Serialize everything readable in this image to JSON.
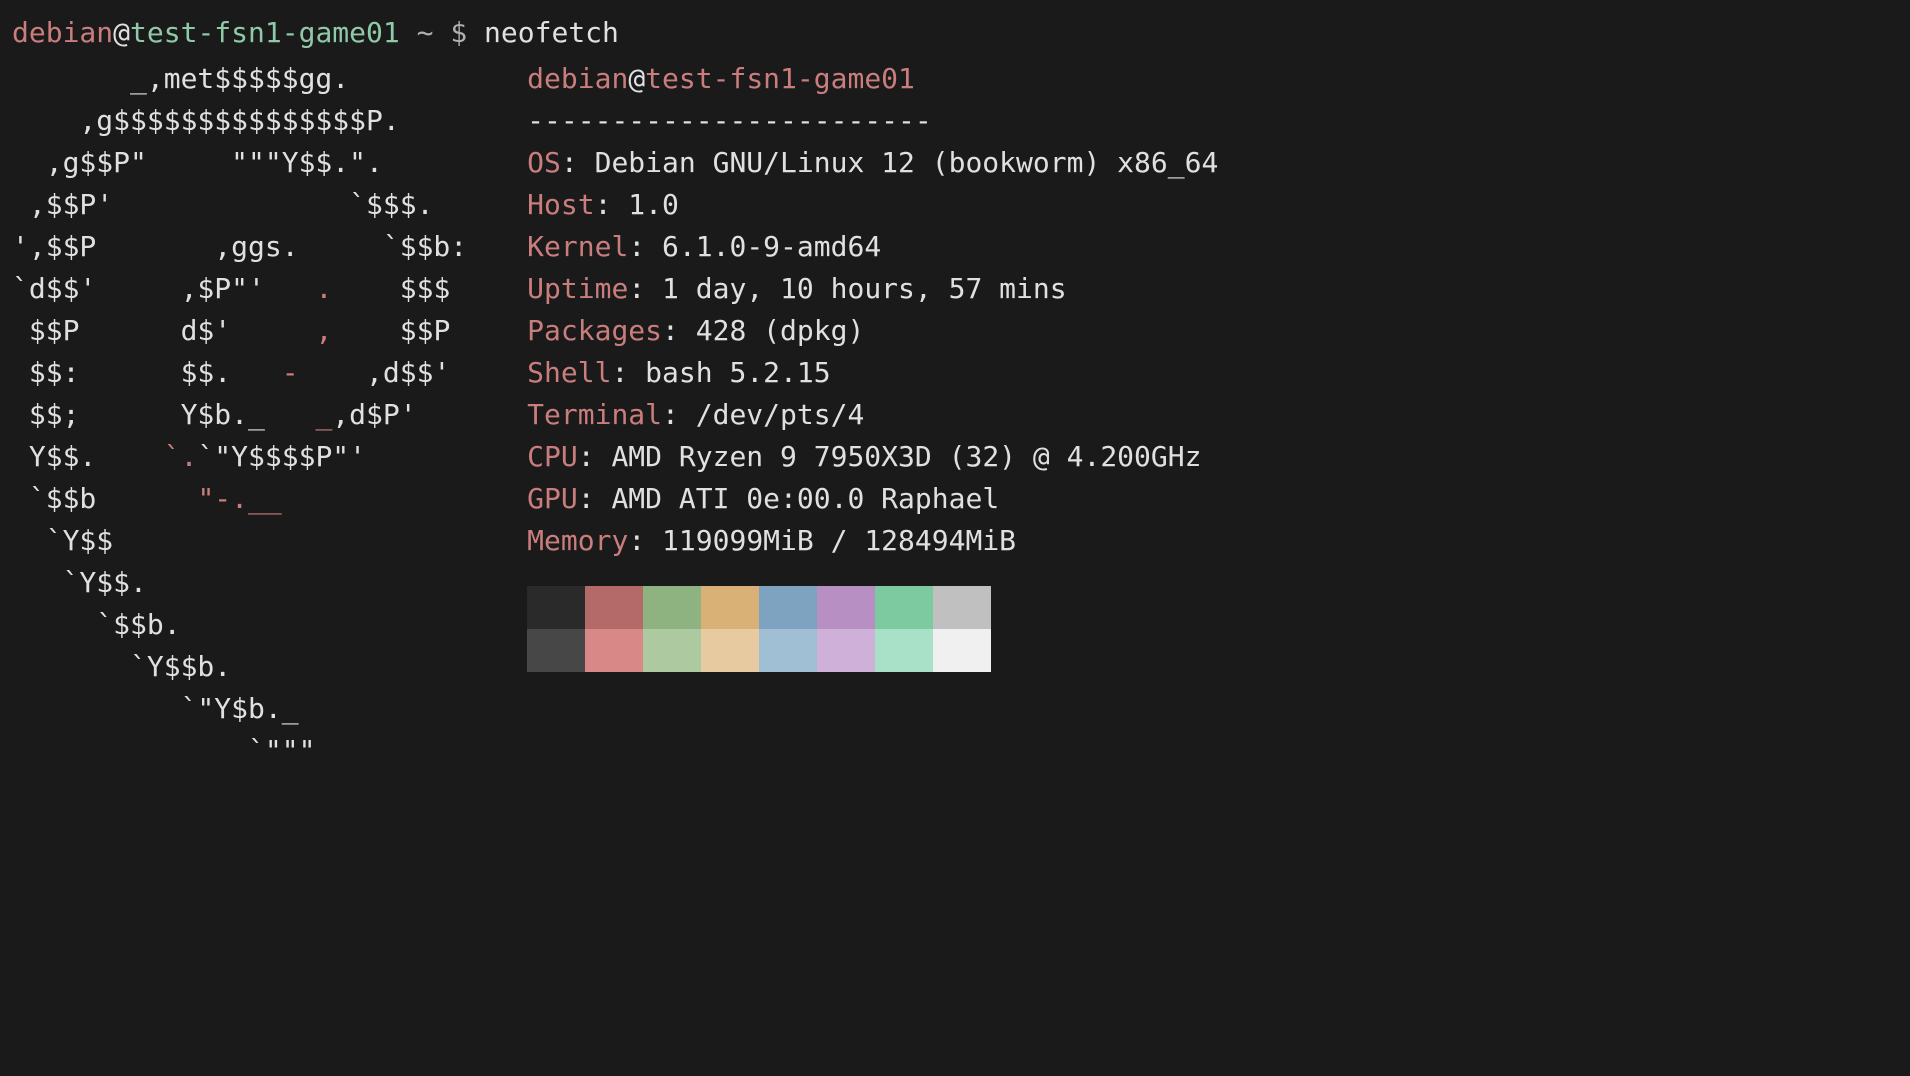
{
  "prompt": {
    "user": "debian",
    "at": "@",
    "host": "test-fsn1-game01",
    "path": "~",
    "symbol": "$",
    "command": "neofetch"
  },
  "ascii": {
    "l0": "       _,met$$$$$gg.",
    "l1": "    ,g$$$$$$$$$$$$$$$P.",
    "l2": "  ,g$$P\"     \"\"\"Y$$.\".",
    "l3": " ,$$P'              `$$$.",
    "l4": "',$$P       ,ggs.     `$$b:",
    "l5a": "`d$$'     ,$P\"'   ",
    "l5b": ".",
    "l5c": "    $$$",
    "l6a": " $$P      d$'     ",
    "l6b": ",",
    "l6c": "    $$P",
    "l7a": " $$:      $$.   ",
    "l7b": "-",
    "l7c": "    ,d$$'",
    "l8a": " $$;      Y$b._   ",
    "l8b": "_",
    "l8c": ",d$P'",
    "l9a": " Y$$.    ",
    "l9b": "`.",
    "l9c": "`\"Y$$$$P\"'",
    "l10a": " `$$b      ",
    "l10b": "\"-.__",
    "l11": "  `Y$$",
    "l12": "   `Y$$.",
    "l13": "     `$$b.",
    "l14": "       `Y$$b.",
    "l15": "          `\"Y$b._",
    "l16": "              `\"\"\""
  },
  "header": {
    "user": "debian",
    "at": "@",
    "host": "test-fsn1-game01"
  },
  "dashes": "------------------------",
  "info": {
    "os_label": "OS",
    "os_value": ": Debian GNU/Linux 12 (bookworm) x86_64",
    "host_label": "Host",
    "host_value": ": 1.0",
    "kernel_label": "Kernel",
    "kernel_value": ": 6.1.0-9-amd64",
    "uptime_label": "Uptime",
    "uptime_value": ": 1 day, 10 hours, 57 mins",
    "packages_label": "Packages",
    "packages_value": ": 428 (dpkg)",
    "shell_label": "Shell",
    "shell_value": ": bash 5.2.15",
    "terminal_label": "Terminal",
    "terminal_value": ": /dev/pts/4",
    "cpu_label": "CPU",
    "cpu_value": ": AMD Ryzen 9 7950X3D (32) @ 4.200GHz",
    "gpu_label": "GPU",
    "gpu_value": ": AMD ATI 0e:00.0 Raphael",
    "memory_label": "Memory",
    "memory_value": ": 119099MiB / 128494MiB"
  },
  "colors": {
    "row1": [
      "#2a2a2a",
      "#b56a6a",
      "#8fb380",
      "#d9b075",
      "#7ea3c0",
      "#b88fc2",
      "#7dc9a0",
      "#c0c0c0"
    ],
    "row2": [
      "#474747",
      "#d98888",
      "#adc9a0",
      "#e8caa0",
      "#a0bfd4",
      "#cfb0d8",
      "#a8e0c8",
      "#f0f0f0"
    ]
  }
}
